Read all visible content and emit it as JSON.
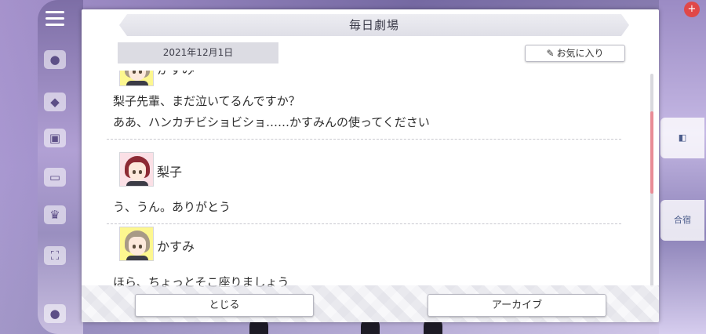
{
  "dialog": {
    "title": "毎日劇場",
    "date": "2021年12月1日",
    "favorite_label": "お気に入り",
    "favorite_icon": "pin-icon",
    "entries": [
      {
        "speaker": "かすみ",
        "avatar": "kasumi",
        "lines": [
          "梨子先輩、まだ泣いてるんですか？",
          "ああ、ハンカチビショビショ……かすみんの使ってください"
        ]
      },
      {
        "speaker": "梨子",
        "avatar": "riko",
        "lines": [
          "う、うん。ありがとう"
        ]
      },
      {
        "speaker": "かすみ",
        "avatar": "kasumi",
        "lines": [
          "ほら、ちょっとそこ座りましょう"
        ]
      }
    ],
    "close_label": "とじる",
    "archive_label": "アーカイブ"
  },
  "background": {
    "right_panel_label": "合宿",
    "badge": "+"
  },
  "colors": {
    "scroll_thumb": "#e98c96",
    "kasumi_avatar_bg": "#fdf78f",
    "riko_avatar_bg": "#fbe0e6"
  }
}
